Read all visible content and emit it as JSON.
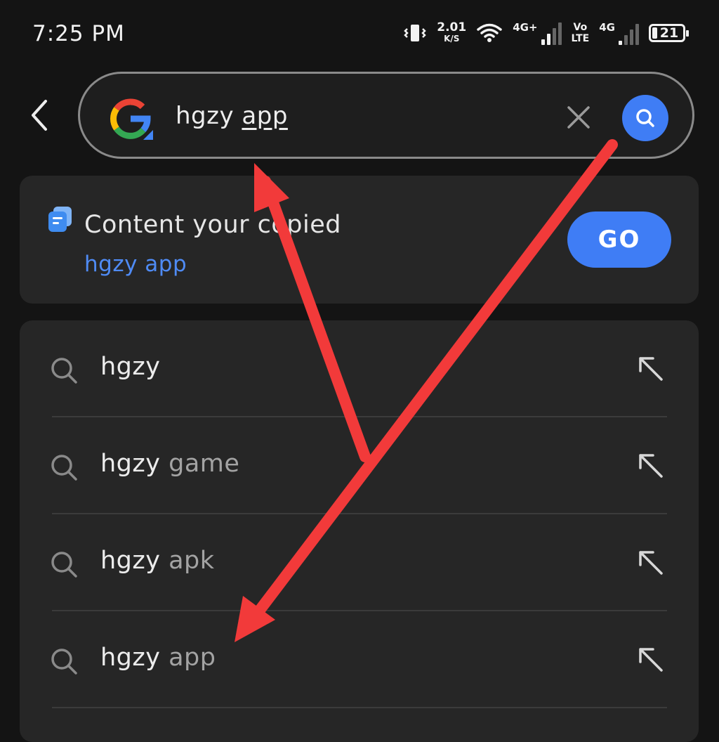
{
  "status_bar": {
    "time": "7:25 PM",
    "net_speed_value": "2.01",
    "net_speed_unit": "K/S",
    "sim1_label": "4G+",
    "volte_top": "Vo",
    "volte_bottom": "LTE",
    "sim2_label": "4G",
    "battery": "21",
    "icons": [
      "vibrate-icon",
      "wifi-icon",
      "signal-icon",
      "battery-icon"
    ]
  },
  "search": {
    "query_main": "hgzy ",
    "query_underlined": "app",
    "colors": {
      "accent": "#3f7df5"
    }
  },
  "clipboard": {
    "title": "Content your copied",
    "content": "hgzy app",
    "go_label": "GO"
  },
  "suggestions": [
    {
      "query": "hgzy",
      "suffix": ""
    },
    {
      "query": "hgzy",
      "suffix": " game"
    },
    {
      "query": "hgzy",
      "suffix": " apk"
    },
    {
      "query": "hgzy",
      "suffix": " app"
    }
  ],
  "annotation": {
    "color": "#f23a3a",
    "shape": "two red arrows"
  }
}
